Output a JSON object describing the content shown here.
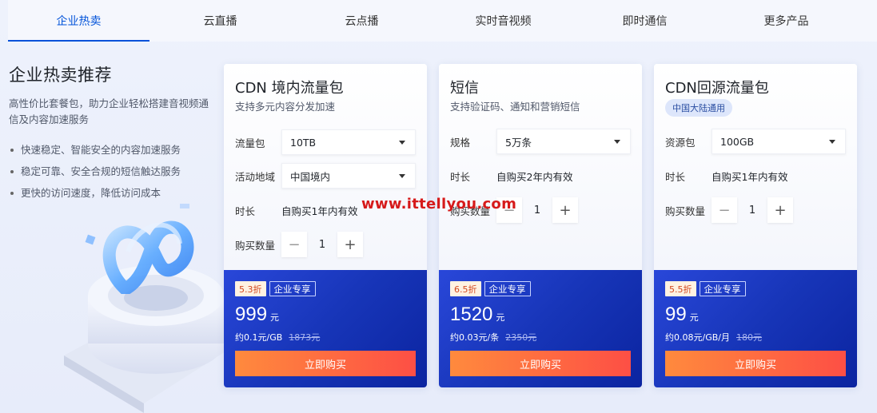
{
  "tabs": [
    {
      "label": "企业热卖",
      "active": true
    },
    {
      "label": "云直播",
      "active": false
    },
    {
      "label": "云点播",
      "active": false
    },
    {
      "label": "实时音视频",
      "active": false
    },
    {
      "label": "即时通信",
      "active": false
    },
    {
      "label": "更多产品",
      "active": false
    }
  ],
  "intro": {
    "title": "企业热卖推荐",
    "description": "高性价比套餐包，助力企业轻松搭建音视频通信及内容加速服务",
    "bullets": [
      "快速稳定、智能安全的内容加速服务",
      "稳定可靠、安全合规的短信触达服务",
      "更快的访问速度，降低访问成本"
    ]
  },
  "colors": {
    "accent": "#0052d9",
    "card_bottom": "#1735b8",
    "buy_button": "#fd4f45",
    "watermark": "#d61a1a"
  },
  "cards": [
    {
      "title": "CDN 境内流量包",
      "subtitle": "支持多元内容分发加速",
      "select1_label": "流量包",
      "select1_value": "10TB",
      "select2_label": "活动地域",
      "select2_value": "中国境内",
      "duration_label": "时长",
      "duration_value": "自购买1年内有效",
      "qty_label": "购买数量",
      "qty_value": "1",
      "discount": "5.3折",
      "enterprise_tag": "企业专享",
      "price": "999",
      "price_unit": "元",
      "unit_price": "约0.1元/GB",
      "original_price": "1873元",
      "buy_label": "立即购买"
    },
    {
      "title": "短信",
      "subtitle": "支持验证码、通知和营销短信",
      "select1_label": "规格",
      "select1_value": "5万条",
      "duration_label": "时长",
      "duration_value": "自购买2年内有效",
      "qty_label": "购买数量",
      "qty_value": "1",
      "discount": "6.5折",
      "enterprise_tag": "企业专享",
      "price": "1520",
      "price_unit": "元",
      "unit_price": "约0.03元/条",
      "original_price": "2350元",
      "buy_label": "立即购买"
    },
    {
      "title": "CDN回源流量包",
      "region_badge": "中国大陆通用",
      "select1_label": "资源包",
      "select1_value": "100GB",
      "duration_label": "时长",
      "duration_value": "自购买1年内有效",
      "qty_label": "购买数量",
      "qty_value": "1",
      "discount": "5.5折",
      "enterprise_tag": "企业专享",
      "price": "99",
      "price_unit": "元",
      "unit_price": "约0.08元/GB/月",
      "original_price": "180元",
      "buy_label": "立即购买"
    }
  ],
  "watermark": "www.ittellyou.com",
  "icons": {
    "caret": "chevron-down-icon",
    "minus": "minus-icon",
    "plus": "plus-icon"
  }
}
